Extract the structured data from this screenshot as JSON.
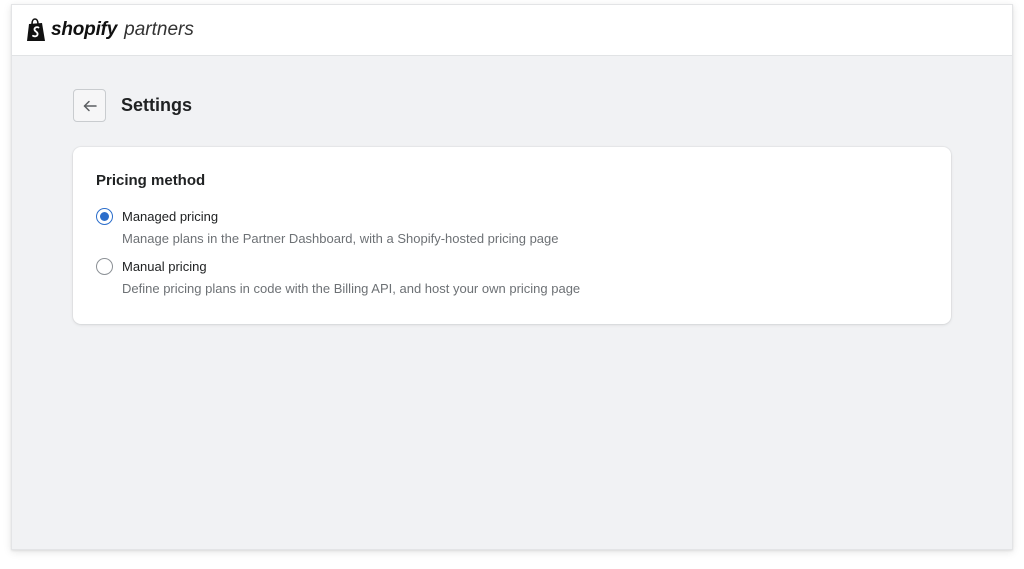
{
  "brand": {
    "name_bold": "shopify",
    "name_light": "partners",
    "icon": "shopify-bag-icon"
  },
  "header": {
    "back_icon": "arrow-left-icon",
    "title": "Settings"
  },
  "pricing": {
    "title": "Pricing method",
    "options": [
      {
        "label": "Managed pricing",
        "help": "Manage plans in the Partner Dashboard, with a Shopify-hosted pricing page",
        "selected": true
      },
      {
        "label": "Manual pricing",
        "help": "Define pricing plans in code with the Billing API, and host your own pricing page",
        "selected": false
      }
    ]
  },
  "colors": {
    "accent": "#2c6ecb",
    "background": "#f1f2f4",
    "text": "#202223",
    "subdued_text": "#6d7175"
  }
}
